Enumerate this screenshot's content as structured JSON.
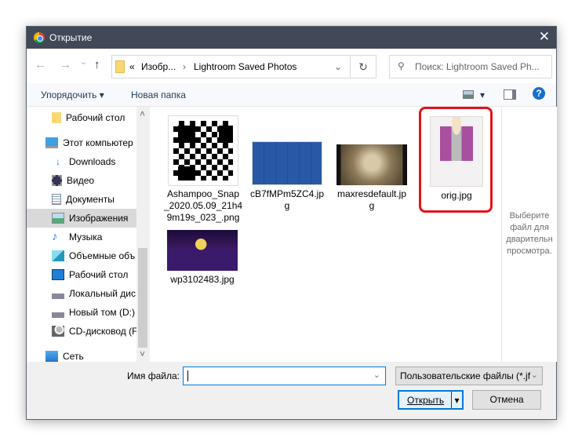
{
  "window": {
    "title": "Открытие",
    "close": "✕"
  },
  "nav": {
    "back": "←",
    "forward": "→",
    "recent": "⌄",
    "up": "↑"
  },
  "address": {
    "chevron": "«",
    "crumbs": [
      "Изобр...",
      "Lightroom Saved Photos"
    ],
    "sep": "›",
    "dropdown": "⌄",
    "refresh": "↻"
  },
  "search": {
    "icon": "⚲",
    "placeholder": "Поиск: Lightroom Saved Ph..."
  },
  "toolbar": {
    "organize": "Упорядочить ▾",
    "new_folder": "Новая папка",
    "view": "▾",
    "help": "?"
  },
  "sidebar": {
    "items": [
      {
        "label": "Рабочий стол",
        "icon": "folder-icon"
      },
      {
        "label": "Этот компьютер",
        "icon": "computer-icon"
      },
      {
        "label": "Downloads",
        "icon": "download-icon"
      },
      {
        "label": "Видео",
        "icon": "video-icon"
      },
      {
        "label": "Документы",
        "icon": "document-icon"
      },
      {
        "label": "Изображения",
        "icon": "pictures-icon",
        "selected": true
      },
      {
        "label": "Музыка",
        "icon": "music-icon"
      },
      {
        "label": "Объемные объ",
        "icon": "3d-objects-icon"
      },
      {
        "label": "Рабочий стол",
        "icon": "desktop-icon"
      },
      {
        "label": "Локальный дис",
        "icon": "drive-icon"
      },
      {
        "label": "Новый том (D:)",
        "icon": "drive-icon"
      },
      {
        "label": "CD-дисковод (F:",
        "icon": "cd-drive-icon"
      },
      {
        "label": "Сеть",
        "icon": "network-icon"
      }
    ],
    "scroll_up": "˄",
    "scroll_down": "˅"
  },
  "files": [
    {
      "name": "Ashampoo_Snap\n_2020.05.09_21h4\n9m19s_023_.png"
    },
    {
      "name": "cB7fMPm5ZC4.jp\ng"
    },
    {
      "name": "maxresdefault.jp\ng"
    },
    {
      "name": "orig.jpg",
      "highlighted": true
    },
    {
      "name": "wp3102483.jpg"
    }
  ],
  "preview": {
    "text": "Выберите\nфайл для\nдварительн\nпросмотра."
  },
  "bottom": {
    "filename_label": "Имя файла:",
    "filename_value": "",
    "filetype": "Пользовательские файлы (*.jf",
    "dd": "⌄",
    "open": "Открыть",
    "open_dd": "▾",
    "cancel": "Отмена"
  },
  "colors": {
    "title_bar": "#414958",
    "highlight": "#e0141c",
    "accent": "#0078d7"
  }
}
